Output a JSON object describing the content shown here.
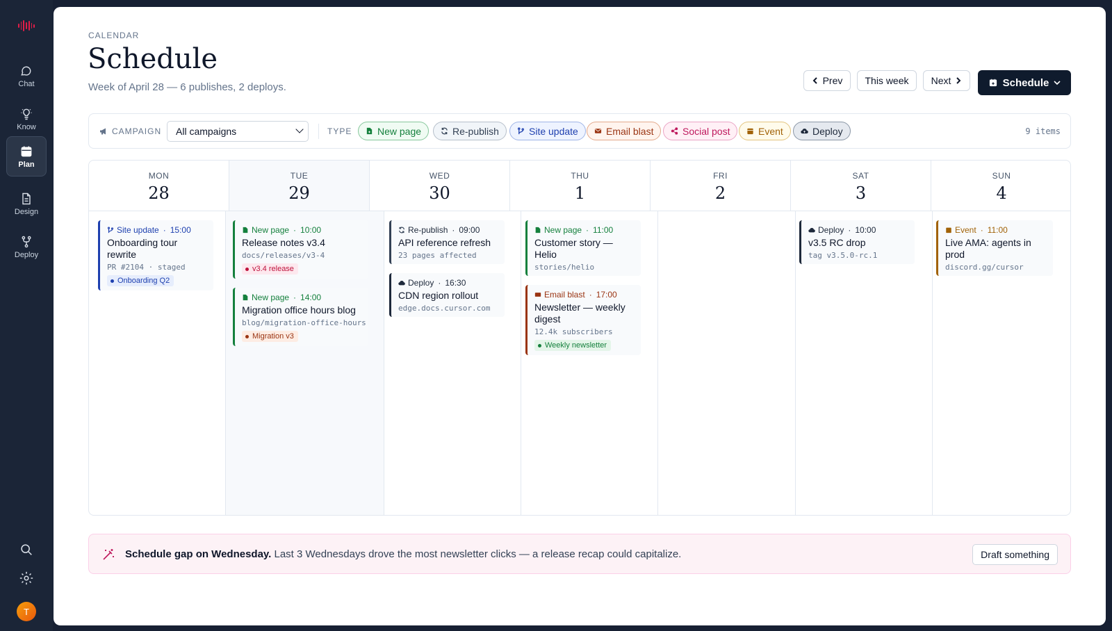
{
  "nav": {
    "items": [
      {
        "label": "Chat",
        "icon": "chat-icon"
      },
      {
        "label": "Know",
        "icon": "lightbulb-icon"
      },
      {
        "label": "Plan",
        "icon": "calendar-icon",
        "active": true
      },
      {
        "label": "Design",
        "icon": "document-icon"
      },
      {
        "label": "Deploy",
        "icon": "branch-icon"
      }
    ],
    "avatar_initial": "T"
  },
  "header": {
    "eyebrow": "CALENDAR",
    "title": "Schedule",
    "subtitle": "Week of April 28 — 6 publishes, 2 deploys.",
    "prev_label": "Prev",
    "this_week_label": "This week",
    "next_label": "Next",
    "schedule_label": "Schedule"
  },
  "filters": {
    "campaign_label": "CAMPAIGN",
    "campaign_value": "All campaigns",
    "type_label": "TYPE",
    "types": [
      "New page",
      "Re-publish",
      "Site update",
      "Email blast",
      "Social post",
      "Event",
      "Deploy"
    ],
    "count": "9 items"
  },
  "colors": {
    "new_page": "#15803d",
    "republish": "#334155",
    "site_update": "#1e40af",
    "email_blast": "#9a3412",
    "social_post": "#be185d",
    "event": "#a16207",
    "deploy": "#1e293b"
  },
  "days": [
    {
      "dow": "MON",
      "num": "28"
    },
    {
      "dow": "TUE",
      "num": "29"
    },
    {
      "dow": "WED",
      "num": "30"
    },
    {
      "dow": "THU",
      "num": "1"
    },
    {
      "dow": "FRI",
      "num": "2"
    },
    {
      "dow": "SAT",
      "num": "3"
    },
    {
      "dow": "SUN",
      "num": "4"
    }
  ],
  "events": {
    "mon_1": {
      "type": "Site update",
      "time": "15:00",
      "title": "Onboarding tour rewrite",
      "sub": "PR #2104 · staged",
      "tag": "Onboarding Q2"
    },
    "tue_1": {
      "type": "New page",
      "time": "10:00",
      "title": "Release notes v3.4",
      "sub": "docs/releases/v3-4",
      "tag": "v3.4 release"
    },
    "tue_2": {
      "type": "New page",
      "time": "14:00",
      "title": "Migration office hours blog",
      "sub": "blog/migration-office-hours",
      "tag": "Migration v3"
    },
    "wed_1": {
      "type": "Re-publish",
      "time": "09:00",
      "title": "API reference refresh",
      "sub": "23 pages affected"
    },
    "wed_2": {
      "type": "Deploy",
      "time": "16:30",
      "title": "CDN region rollout",
      "sub": "edge.docs.cursor.com"
    },
    "thu_1": {
      "type": "New page",
      "time": "11:00",
      "title": "Customer story — Helio",
      "sub": "stories/helio"
    },
    "thu_2": {
      "type": "Email blast",
      "time": "17:00",
      "title": "Newsletter — weekly digest",
      "sub": "12.4k subscribers",
      "tag": "Weekly newsletter"
    },
    "sat_1": {
      "type": "Deploy",
      "time": "10:00",
      "title": "v3.5 RC drop",
      "sub": "tag v3.5.0-rc.1"
    },
    "sun_1": {
      "type": "Event",
      "time": "11:00",
      "title": "Live AMA: agents in prod",
      "sub": "discord.gg/cursor"
    }
  },
  "insight": {
    "bold": "Schedule gap on Wednesday.",
    "text": "Last 3 Wednesdays drove the most newsletter clicks — a release recap could capitalize.",
    "action": "Draft something"
  }
}
